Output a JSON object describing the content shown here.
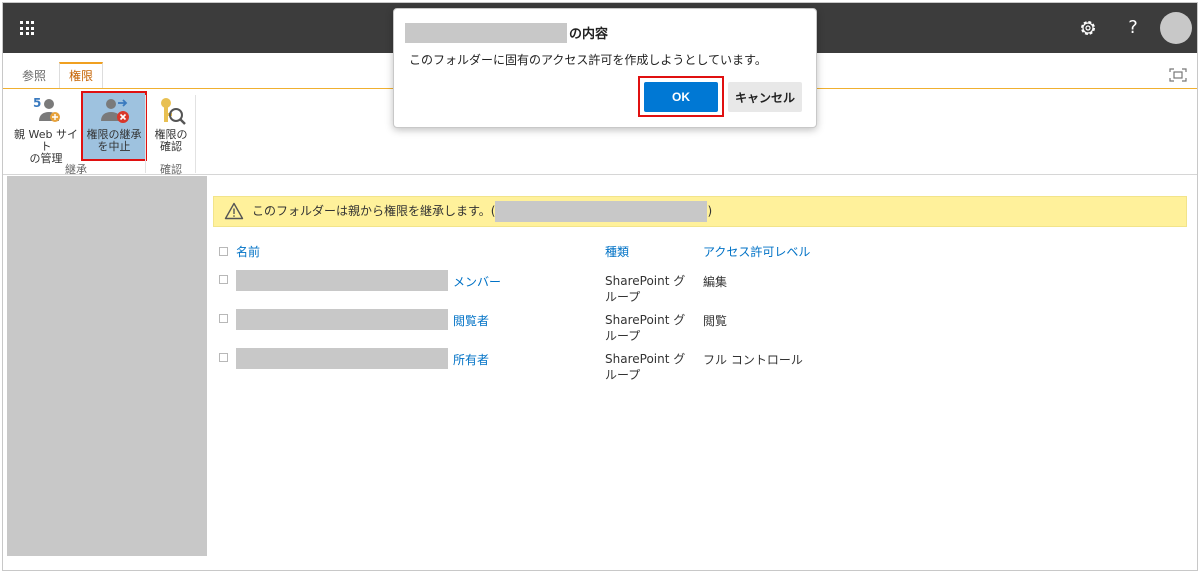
{
  "suitebar": {
    "help_label": "?",
    "icons": [
      "app-launcher-icon",
      "gear-icon",
      "help-icon",
      "avatar"
    ]
  },
  "ribbon": {
    "tabs": [
      {
        "label": "参照",
        "active": false
      },
      {
        "label": "権限",
        "active": true
      }
    ],
    "buttons": {
      "parent_site": "親 Web サイトの管理",
      "parent_site_line1": "親 Web サイト",
      "parent_site_line2": "の管理",
      "stop_inherit_line1": "権限の継承",
      "stop_inherit_line2": "を中止",
      "check_line1": "権限の",
      "check_line2": "確認"
    },
    "groups": {
      "inherit": "継承",
      "check": "確認"
    }
  },
  "infobar": {
    "prefix": "このフォルダーは親から権限を継承します。(",
    "suffix": ")"
  },
  "table": {
    "headers": {
      "name": "名前",
      "type": "種類",
      "level": "アクセス許可レベル"
    },
    "rows": [
      {
        "group": "メンバー",
        "type_line1": "SharePoint グ",
        "type_line2": "ループ",
        "level": "編集"
      },
      {
        "group": "閲覧者",
        "type_line1": "SharePoint グ",
        "type_line2": "ループ",
        "level": "閲覧"
      },
      {
        "group": "所有者",
        "type_line1": "SharePoint グ",
        "type_line2": "ループ",
        "level": "フル コントロール"
      }
    ]
  },
  "dialog": {
    "title_suffix": "の内容",
    "message": "このフォルダーに固有のアクセス許可を作成しようとしています。",
    "ok_label": "OK",
    "cancel_label": "キャンセル"
  },
  "colors": {
    "suitebar": "#3c3c3c",
    "accent_orange": "#f0a020",
    "link_blue": "#0072c6",
    "ok_button": "#0078d4",
    "highlight_red": "#e01010",
    "infobar_yellow": "#fff19b"
  }
}
